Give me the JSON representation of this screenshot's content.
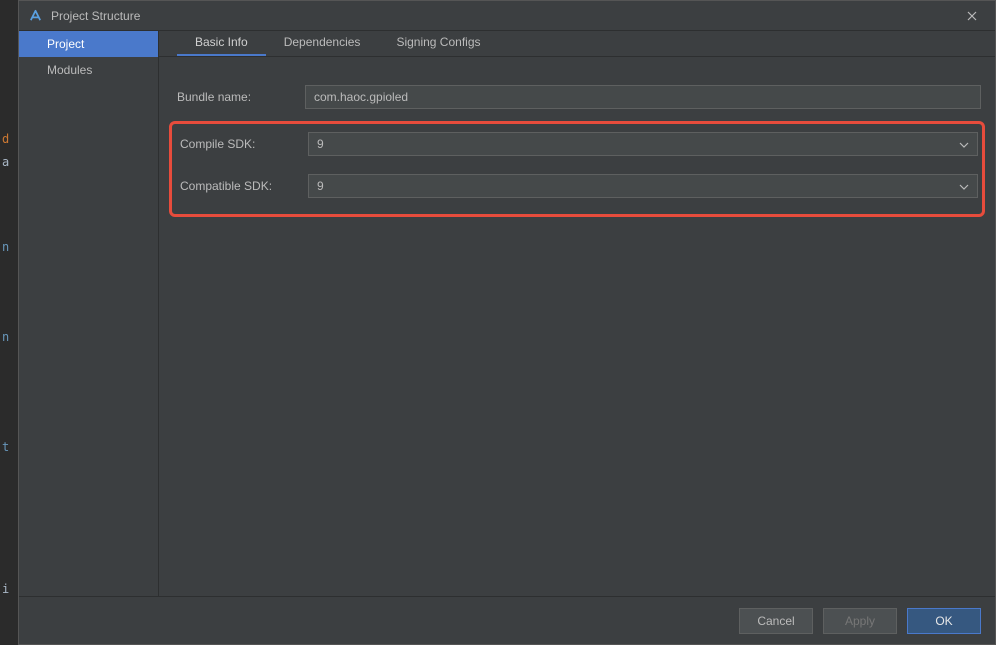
{
  "bg_tokens": {
    "t1": "d",
    "t2": "a",
    "t3": "n",
    "t4": "n",
    "t5": "t",
    "t6": "i"
  },
  "titlebar": {
    "title": "Project Structure"
  },
  "sidebar": {
    "items": [
      {
        "label": "Project",
        "active": true
      },
      {
        "label": "Modules",
        "active": false
      }
    ]
  },
  "tabs": [
    {
      "label": "Basic Info",
      "active": true
    },
    {
      "label": "Dependencies",
      "active": false
    },
    {
      "label": "Signing Configs",
      "active": false
    }
  ],
  "form": {
    "bundle_name_label": "Bundle name:",
    "bundle_name_value": "com.haoc.gpioled",
    "compile_sdk_label": "Compile SDK:",
    "compile_sdk_value": "9",
    "compatible_sdk_label": "Compatible SDK:",
    "compatible_sdk_value": "9"
  },
  "footer": {
    "cancel": "Cancel",
    "apply": "Apply",
    "ok": "OK"
  }
}
